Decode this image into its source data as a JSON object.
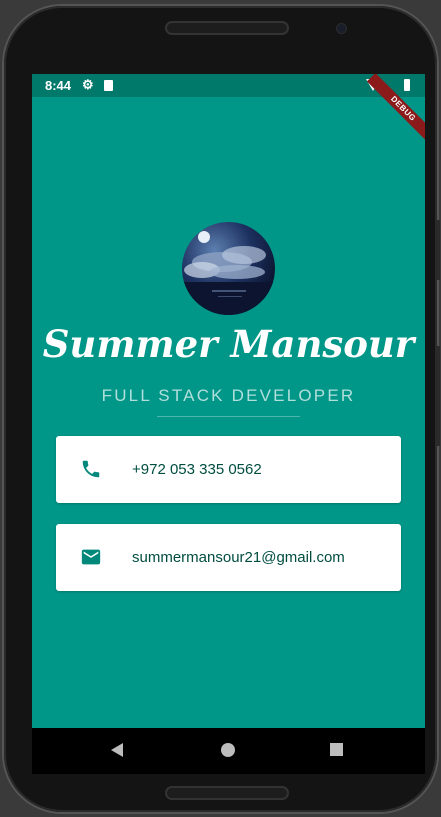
{
  "status_bar": {
    "time": "8:44"
  },
  "debug_banner": "DEBUG",
  "profile": {
    "name": "Summer Mansour",
    "title": "FULL STACK DEVELOPER"
  },
  "contacts": [
    {
      "icon": "phone-icon",
      "value": "+972 053 335 0562"
    },
    {
      "icon": "email-icon",
      "value": "summermansour21@gmail.com"
    }
  ],
  "colors": {
    "status_bar": "#00796b",
    "background": "#009688",
    "card": "#ffffff",
    "icon": "#00897b",
    "contact_text": "#004d40",
    "subtitle": "#b2dfdb"
  }
}
